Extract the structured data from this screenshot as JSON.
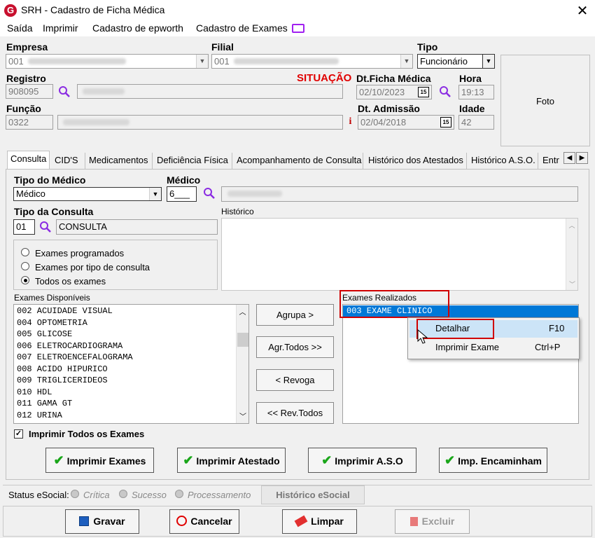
{
  "window": {
    "title": "SRH - Cadastro de Ficha Médica",
    "close_glyph": "✕"
  },
  "menu": [
    "Saída",
    "Imprimir",
    "Cadastro de epworth",
    "Cadastro de Exames"
  ],
  "header": {
    "empresa_label": "Empresa",
    "empresa_code": "001",
    "filial_label": "Filial",
    "filial_code": "001",
    "tipo_label": "Tipo",
    "tipo_value": "Funcionário",
    "registro_label": "Registro",
    "registro_value": "908095",
    "situacao_label": "SITUAÇÃO",
    "dt_ficha_label": "Dt.Ficha Médica",
    "dt_ficha_value": "02/10/2023",
    "hora_label": "Hora",
    "hora_value": "19:13",
    "funcao_label": "Função",
    "funcao_value": "0322",
    "info_glyph": "i",
    "dt_admissao_label": "Dt. Admissão",
    "dt_admissao_value": "02/04/2018",
    "idade_label": "Idade",
    "idade_value": "42",
    "foto_label": "Foto",
    "calendar_glyph": "15"
  },
  "tabs": [
    "Consulta",
    "CID'S",
    "Medicamentos",
    "Deficiência Física",
    "Acompanhamento de Consulta",
    "Histórico dos Atestados",
    "Histórico A.S.O.",
    "Entr"
  ],
  "consulta": {
    "tipo_medico_label": "Tipo do Médico",
    "tipo_medico_value": "Médico",
    "medico_label": "Médico",
    "medico_value": "6___",
    "tipo_consulta_label": "Tipo da Consulta",
    "tipo_consulta_code": "01",
    "tipo_consulta_value": "CONSULTA",
    "historico_label": "Histórico",
    "radios": [
      {
        "label": "Exames programados",
        "selected": false
      },
      {
        "label": "Exames por tipo de consulta",
        "selected": false
      },
      {
        "label": "Todos os exames",
        "selected": true
      }
    ],
    "disponiveis_label": "Exames Disponíveis",
    "disponiveis": [
      "002 ACUIDADE VISUAL",
      "004 OPTOMETRIA",
      "005 GLICOSE",
      "006 ELETROCARDIOGRAMA",
      "007 ELETROENCEFALOGRAMA",
      "008 ACIDO HIPURICO",
      "009 TRIGLICERIDEOS",
      "010 HDL",
      "011 GAMA GT",
      "012 URINA"
    ],
    "buttons": {
      "agrupa": "Agrupa >",
      "agr_todos": "Agr.Todos >>",
      "revoga": "< Revoga",
      "rev_todos": "<< Rev.Todos"
    },
    "realizados_label": "Exames Realizados",
    "realizados": [
      "003 EXAME CLINICO"
    ],
    "imprimir_todos_label": "Imprimir Todos os Exames",
    "action_buttons": [
      "Imprimir Exames",
      "Imprimir Atestado",
      "Imprimir A.S.O",
      "Imp. Encaminham"
    ]
  },
  "context_menu": [
    {
      "label": "Detalhar",
      "shortcut": "F10"
    },
    {
      "label": "Imprimir Exame",
      "shortcut": "Ctrl+P"
    }
  ],
  "status_bar": {
    "label": "Status eSocial:",
    "options": [
      "Crítica",
      "Sucesso",
      "Processamento"
    ],
    "historico_button": "Histórico eSocial"
  },
  "footer_buttons": {
    "gravar": "Gravar",
    "cancelar": "Cancelar",
    "limpar": "Limpar",
    "excluir": "Excluir"
  },
  "colors": {
    "accent_red": "#e00000",
    "selection_blue": "#0078d7",
    "highlight_box": "#d00000",
    "check_green": "#1aa61a",
    "search_purple": "#8a2be2"
  }
}
